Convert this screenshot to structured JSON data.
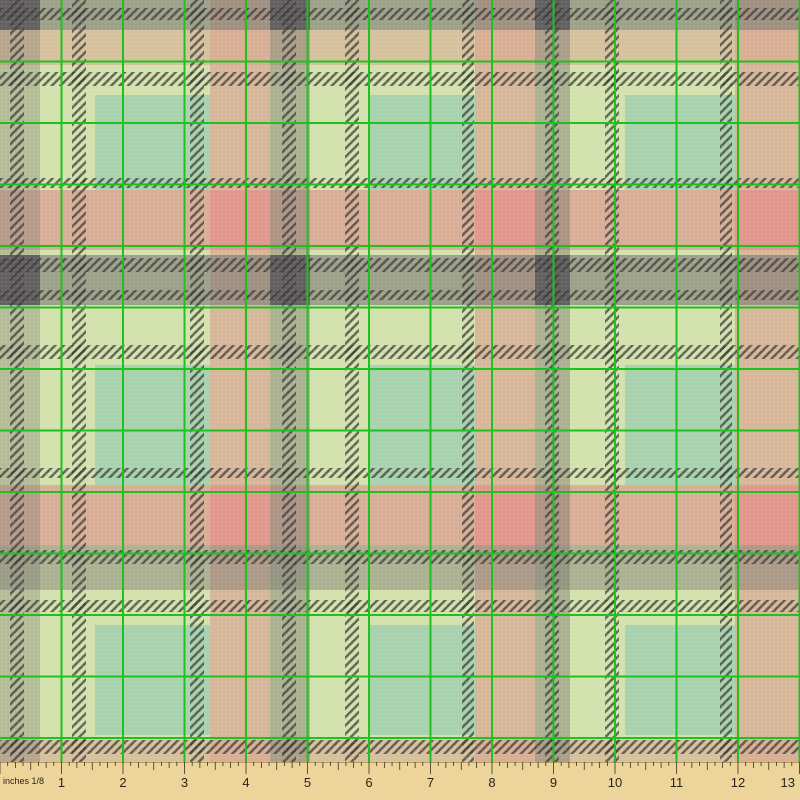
{
  "fabric": {
    "pattern": "plaid",
    "colors": {
      "cream_green": "#d3e2ac",
      "mint": "#a7d2ad",
      "salmon": "#d8a592",
      "rose": "#e2978d",
      "charcoal": "#626060",
      "taupe": "#c1ad98",
      "twill_dark": "#4c4a48",
      "grid_line": "#1ec21e"
    }
  },
  "ruler": {
    "unit_label": "inches 1/8",
    "numbers": [
      "1",
      "2",
      "3",
      "4",
      "5",
      "6",
      "7",
      "8",
      "9",
      "10",
      "11",
      "12",
      "13"
    ],
    "color": "#edd49a"
  }
}
